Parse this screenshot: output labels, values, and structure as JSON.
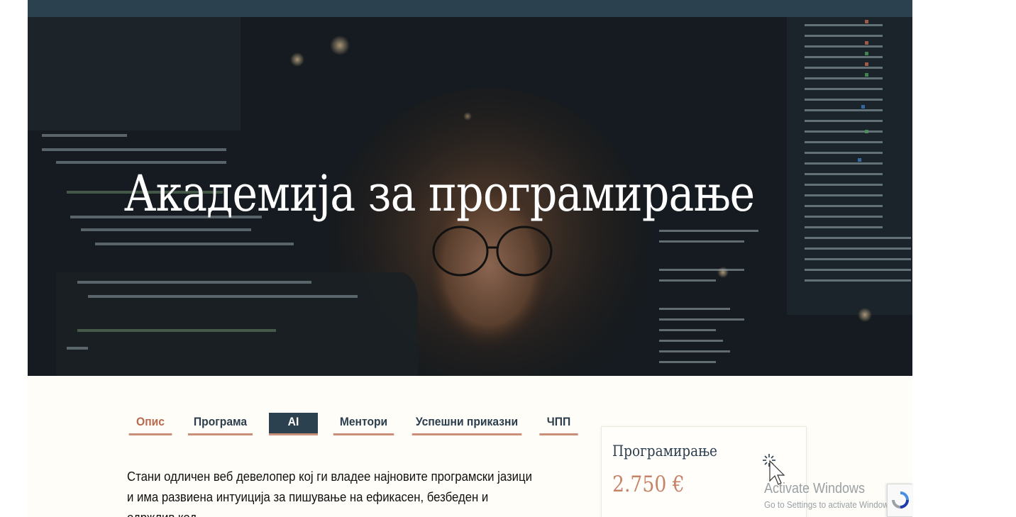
{
  "hero": {
    "title": "Академија за програмирање"
  },
  "tabs": [
    {
      "label": "Опис",
      "state": "current"
    },
    {
      "label": "Програма",
      "state": "default"
    },
    {
      "label": "AI",
      "state": "selected"
    },
    {
      "label": "Ментори",
      "state": "default"
    },
    {
      "label": "Успешни приказни",
      "state": "default"
    },
    {
      "label": "ЧПП",
      "state": "default"
    }
  ],
  "description": "Стани одличен веб девелопер кој ги владее најновите програмски јазици и има развиена интуиција за пишување на ефикасен, безбеден и одржлив код.",
  "price_card": {
    "name": "Програмирање",
    "price": "2.750 €"
  },
  "windows_watermark": {
    "title": "Activate Windows",
    "subtitle": "Go to Settings to activate Windows."
  },
  "colors": {
    "nav_dark": "#2c4150",
    "accent": "#c98f78",
    "price": "#c58468",
    "content_bg": "#fffdf7"
  },
  "icons": [
    "loading-cursor-icon",
    "recaptcha-icon"
  ]
}
